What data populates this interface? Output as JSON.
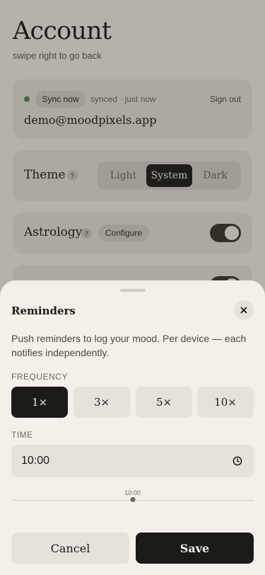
{
  "page": {
    "title": "Account",
    "subtitle": "swipe right to go back"
  },
  "sync": {
    "button_label": "Sync now",
    "status": "synced · just now",
    "sign_out_label": "Sign out",
    "email": "demo@moodpixels.app",
    "status_color": "#4b8a4f"
  },
  "theme": {
    "label": "Theme",
    "help": "?",
    "options": [
      "Light",
      "System",
      "Dark"
    ],
    "selected": "System"
  },
  "astrology": {
    "label": "Astrology",
    "help": "?",
    "configure_label": "Configure",
    "enabled": true
  },
  "reminders_row": {
    "enabled": true
  },
  "sheet": {
    "title": "Reminders",
    "close_icon": "close-icon",
    "description": "Push reminders to log your mood. Per device — each notifies independently.",
    "frequency_label": "FREQUENCY",
    "frequency_options": [
      "1×",
      "3×",
      "5×",
      "10×"
    ],
    "frequency_selected": "1×",
    "time_label": "TIME",
    "time_value": "10:00",
    "time_icon": "clock-icon",
    "slider_value": "10:00",
    "slider_fraction": 0.5,
    "cancel_label": "Cancel",
    "save_label": "Save"
  },
  "colors": {
    "background": "#f3f0ea",
    "accent": "#1b1a17",
    "card": "#e5e2dc"
  }
}
